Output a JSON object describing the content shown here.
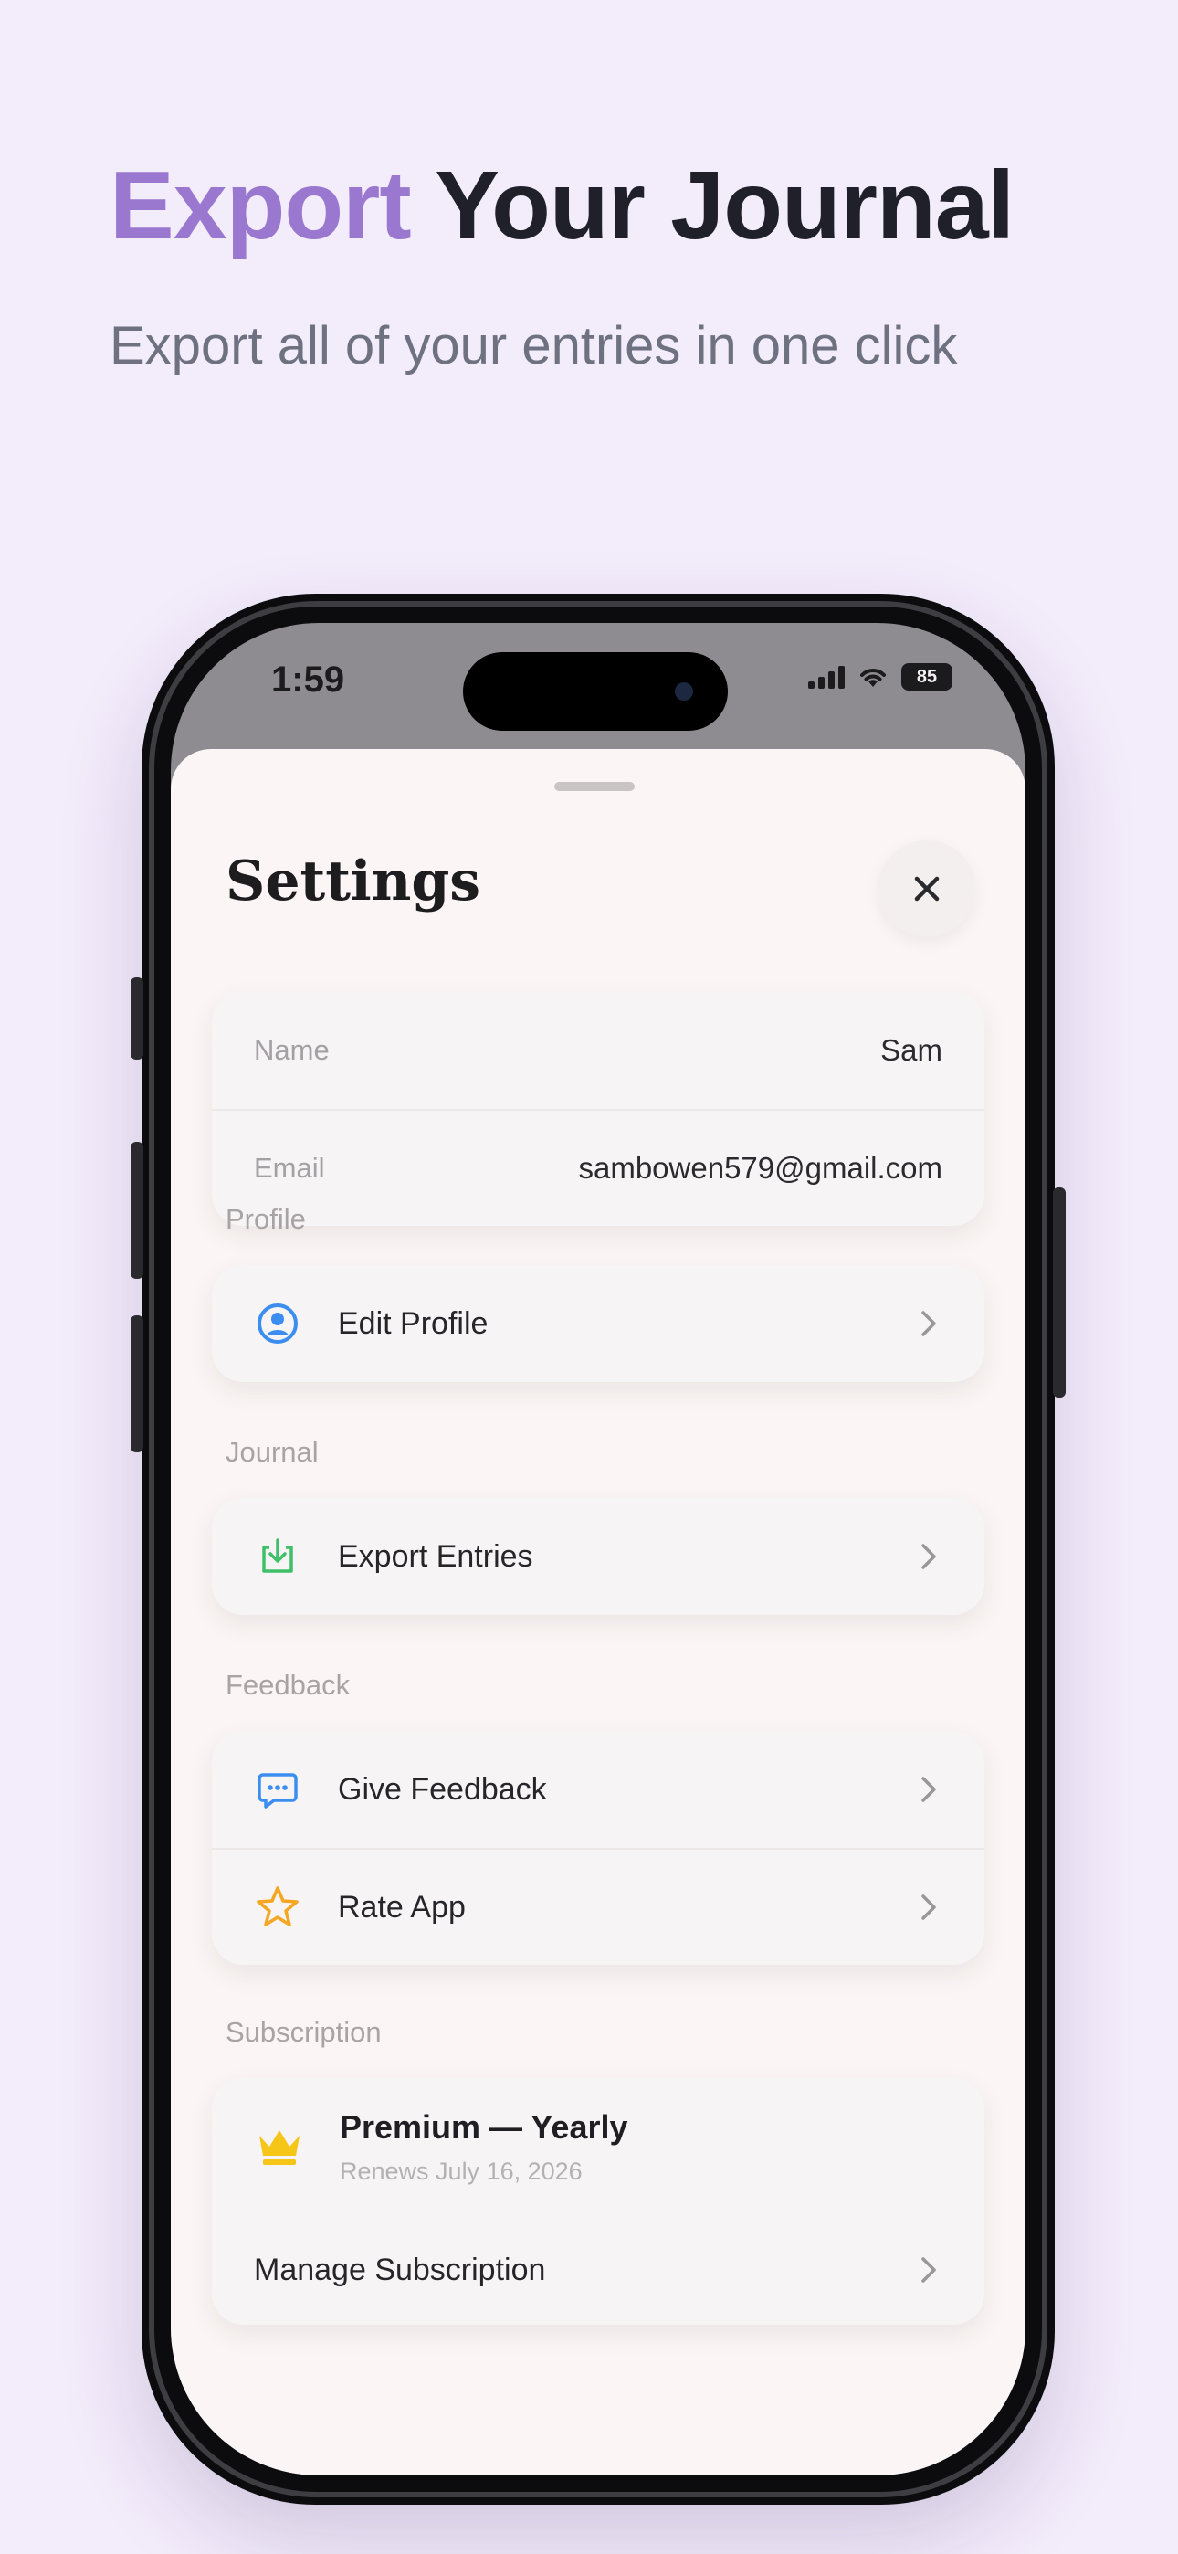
{
  "hero": {
    "title_accent": "Export",
    "title_rest": "Your Journal",
    "subtitle": "Export all of your entries in one click"
  },
  "status_bar": {
    "time": "1:59",
    "battery": "85"
  },
  "settings": {
    "title": "Settings",
    "account": {
      "name_label": "Name",
      "name_value": "Sam",
      "email_label": "Email",
      "email_value": "sambowen579@gmail.com"
    },
    "sections": {
      "profile": "Profile",
      "journal": "Journal",
      "feedback": "Feedback",
      "subscription": "Subscription"
    },
    "items": {
      "edit_profile": "Edit Profile",
      "export_entries": "Export Entries",
      "give_feedback": "Give Feedback",
      "rate_app": "Rate App"
    },
    "subscription": {
      "plan": "Premium — Yearly",
      "renews": "Renews July 16, 2026",
      "manage": "Manage Subscription"
    }
  },
  "icons": {
    "edit_profile": "person-circle-icon",
    "export_entries": "download-tray-icon",
    "give_feedback": "chat-bubble-icon",
    "rate_app": "star-icon",
    "subscription": "crown-icon"
  },
  "colors": {
    "accent": "#9a78cf",
    "profile_icon": "#3b8ef0",
    "export_icon": "#3fbf6a",
    "feedback_icon": "#3b8ef0",
    "rate_icon": "#f5a623",
    "crown_icon": "#f5c518"
  }
}
